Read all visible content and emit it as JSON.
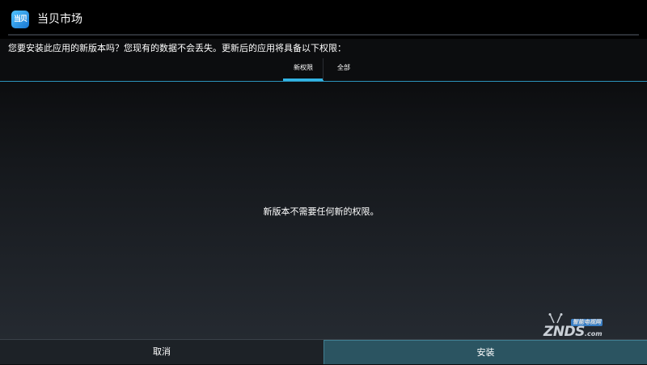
{
  "header": {
    "app_icon_text": "当贝",
    "app_title": "当贝市场"
  },
  "prompt": {
    "text": "您要安装此应用的新版本吗？您现有的数据不会丢失。更新后的应用将具备以下权限："
  },
  "tabs": [
    {
      "label": "新权限",
      "active": true
    },
    {
      "label": "全部",
      "active": false
    }
  ],
  "main": {
    "message": "新版本不需要任何新的权限。"
  },
  "footer": {
    "cancel_label": "取消",
    "install_label": "安装"
  },
  "watermark": {
    "subtitle": "智能电视网",
    "brand": "ZNDS",
    "suffix": ".com"
  },
  "colors": {
    "accent": "#33b5e5",
    "install_button_bg": "#2b5461",
    "titlebar_bg": "#000000"
  }
}
